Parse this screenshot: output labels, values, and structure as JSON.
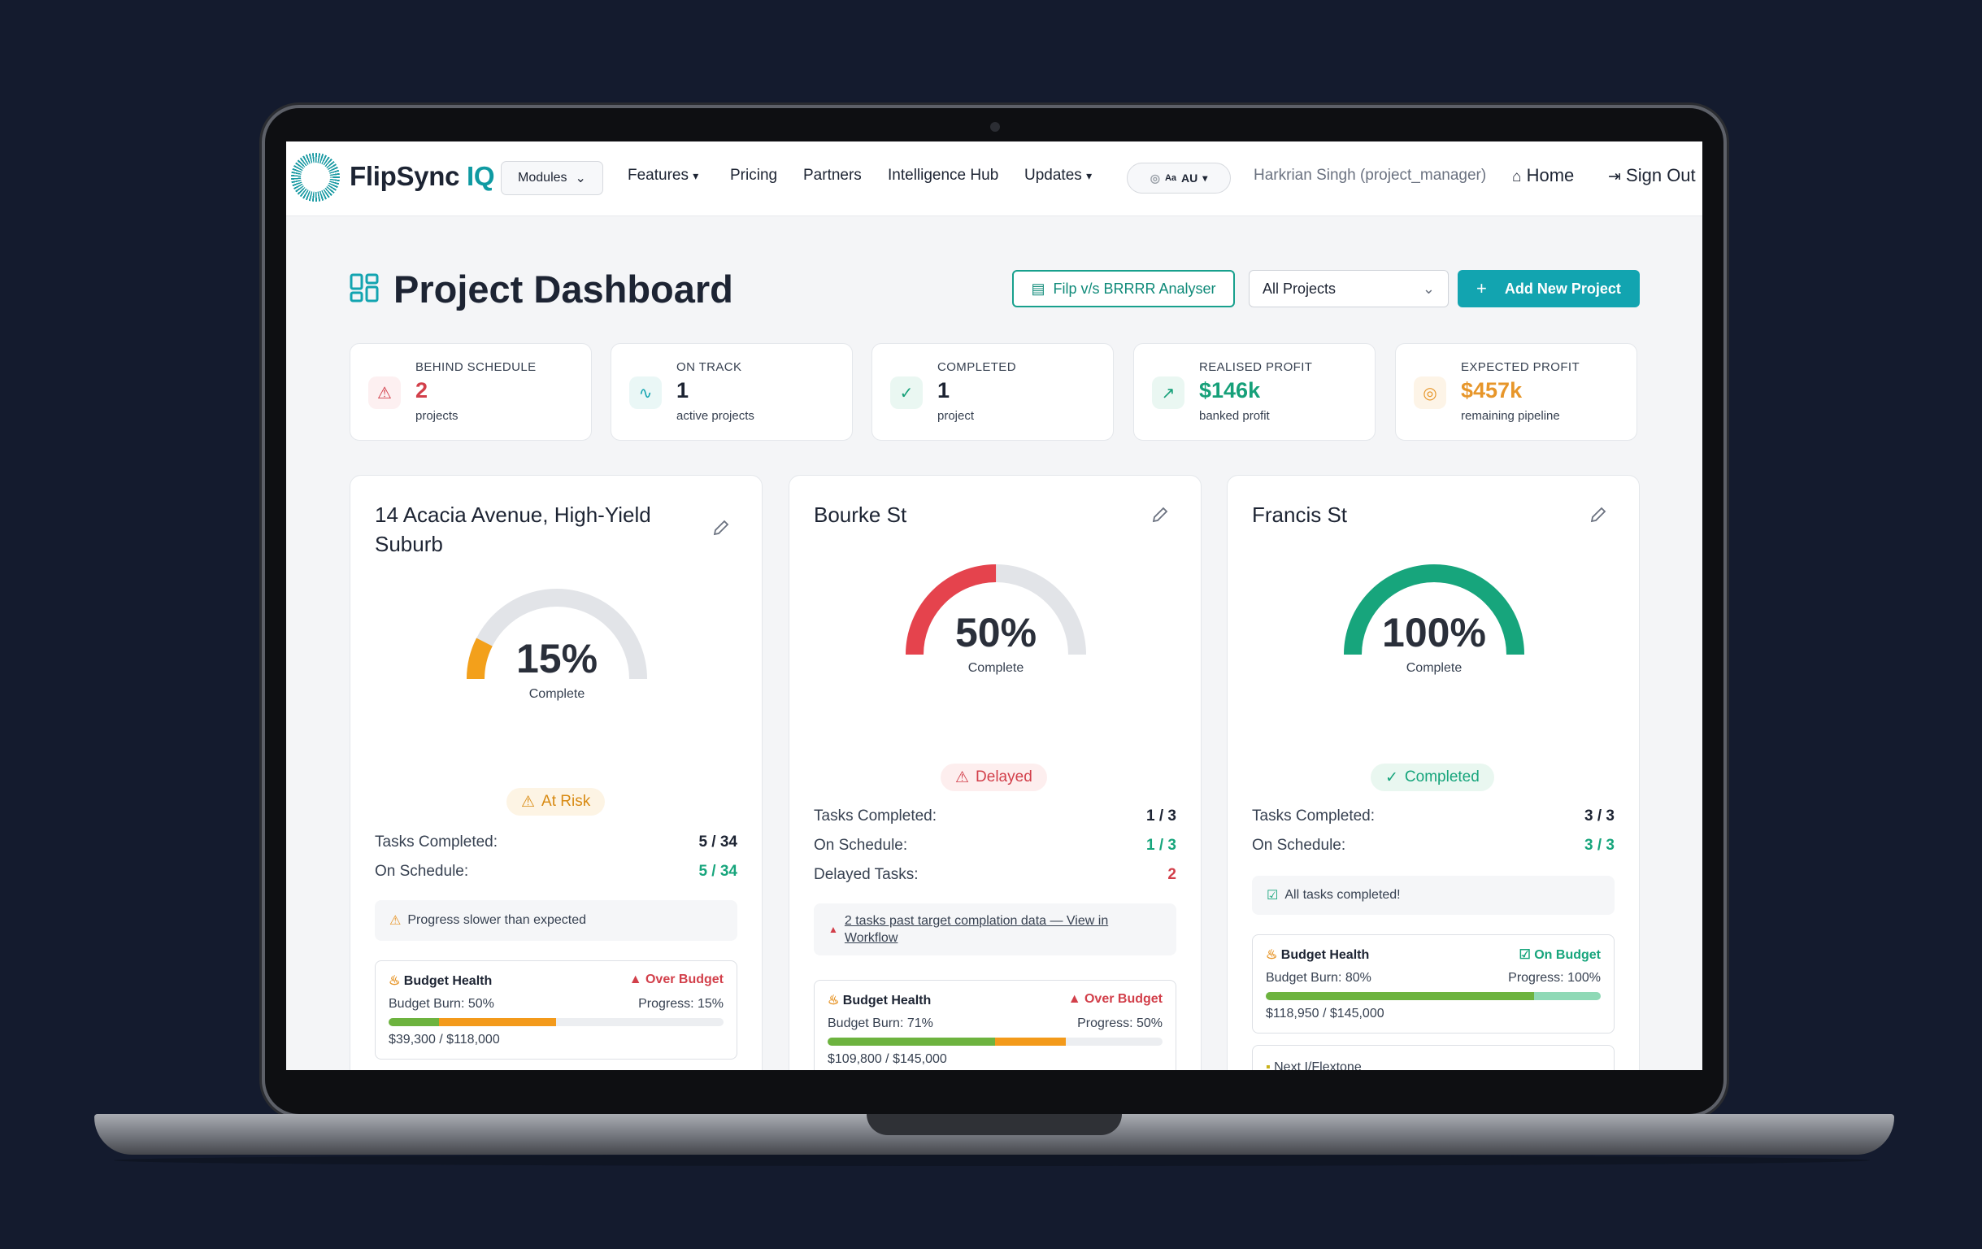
{
  "nav": {
    "brand_main": "FlipSync",
    "brand_iq": "IQ",
    "modules": "Modules",
    "features": "Features",
    "pricing": "Pricing",
    "partners": "Partners",
    "intelligence_hub": "Intelligence Hub",
    "updates": "Updates",
    "locale": "AU",
    "user": "Harkrian Singh (project_manager)",
    "home": "Home",
    "sign_out": "Sign Out"
  },
  "header": {
    "title": "Project Dashboard",
    "flip_button": "Filp v/s BRRRR Analyser",
    "project_filter": "All Projects",
    "add_button": "Add New Project"
  },
  "stats": [
    {
      "label": "BEHIND SCHEDULE",
      "value": "2",
      "sub": "projects",
      "color": "#d23f4a",
      "icon": "alert-triangle-icon"
    },
    {
      "label": "ON TRACK",
      "value": "1",
      "sub": "active projects",
      "color": "#1d2433",
      "icon": "activity-icon"
    },
    {
      "label": "COMPLETED",
      "value": "1",
      "sub": "project",
      "color": "#1d2433",
      "icon": "check-circle-icon"
    },
    {
      "label": "REALISED PROFIT",
      "value": "$146k",
      "sub": "banked profit",
      "color": "#16a079",
      "icon": "trending-up-icon"
    },
    {
      "label": "EXPECTED PROFIT",
      "value": "$457k",
      "sub": "remaining pipeline",
      "color": "#e7962a",
      "icon": "target-icon"
    }
  ],
  "projects": [
    {
      "title": "14 Acacia Avenue, High-Yield Suburb",
      "progress": 0.15,
      "percent": "15%",
      "complete_label": "Complete",
      "gauge_color": "#f3a01b",
      "status": "At Risk",
      "tasks_label": "Tasks Completed:",
      "tasks_value": "5 / 34",
      "schedule_label": "On Schedule:",
      "schedule_value": "5 / 34",
      "note": "Progress slower than expected",
      "budget_title": "Budget Health",
      "budget_status": "Over Budget",
      "burn": "Budget Burn: 50%",
      "prog": "Progress: 15%",
      "burn_fraction": 0.5,
      "amount": "$39,300 / $118,000"
    },
    {
      "title": "Bourke St",
      "progress": 0.5,
      "percent": "50%",
      "complete_label": "Complete",
      "gauge_color": "#e5434d",
      "status": "Delayed",
      "tasks_label": "Tasks Completed:",
      "tasks_value": "1 / 3",
      "schedule_label": "On Schedule:",
      "schedule_value": "1 / 3",
      "delayed_label": "Delayed Tasks:",
      "delayed_value": "2",
      "note": "2 tasks past target complation data — View in Workflow",
      "budget_title": "Budget Health",
      "budget_status": "Over Budget",
      "burn": "Budget Burn: 71%",
      "prog": "Progress: 50%",
      "burn_fraction": 0.71,
      "amount": "$109,800 / $145,000"
    },
    {
      "title": "Francis St",
      "progress": 1.0,
      "percent": "100%",
      "complete_label": "Complete",
      "gauge_color": "#17a57c",
      "status": "Completed",
      "tasks_label": "Tasks Completed:",
      "tasks_value": "3 / 3",
      "schedule_label": "On Schedule:",
      "schedule_value": "3 / 3",
      "note": "All tasks completed!",
      "budget_title": "Budget Health",
      "budget_status": "On Budget",
      "burn": "Budget Burn: 80%",
      "prog": "Progress: 100%",
      "burn_fraction": 0.8,
      "amount": "$118,950 / $145,000",
      "next_label": "Next I/Flextone"
    }
  ]
}
